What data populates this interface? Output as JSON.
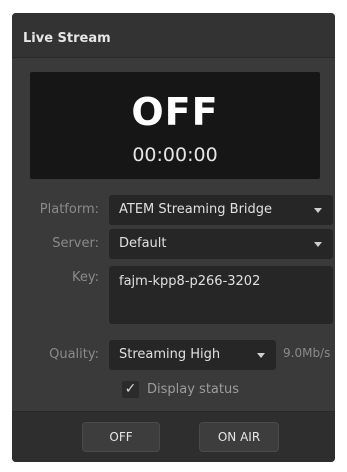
{
  "panel": {
    "title": "Live Stream"
  },
  "display": {
    "status": "OFF",
    "timer": "00:00:00"
  },
  "form": {
    "platform_label": "Platform:",
    "platform_value": "ATEM Streaming Bridge",
    "server_label": "Server:",
    "server_value": "Default",
    "key_label": "Key:",
    "key_value": "fajm-kpp8-p266-3202",
    "quality_label": "Quality:",
    "quality_value": "Streaming High",
    "bitrate": "9.0Mb/s",
    "display_status_label": "Display status",
    "display_status_checked": true
  },
  "buttons": {
    "off_label": "OFF",
    "on_air_label": "ON AIR"
  },
  "icons": {
    "dropdown": "chevron-down-icon",
    "check": "checkmark-icon"
  }
}
